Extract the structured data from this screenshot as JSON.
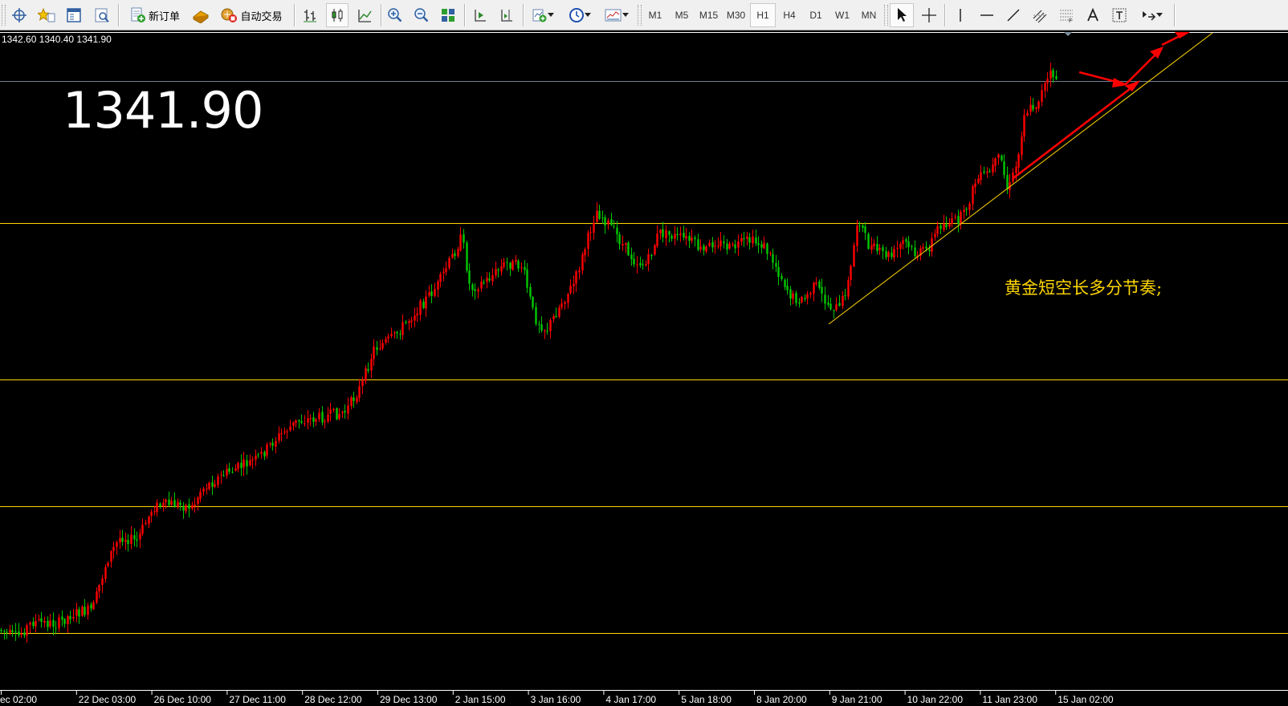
{
  "toolbar": {
    "new_order_label": "新订单",
    "autotrade_label": "自动交易",
    "timeframes": [
      "M1",
      "M5",
      "M15",
      "M30",
      "H1",
      "H4",
      "D1",
      "W1",
      "MN"
    ],
    "active_timeframe": "H1"
  },
  "chart": {
    "ohlc_text": "1342.60 1340.40 1341.90",
    "big_price": "1341.90",
    "annotation": "黄金短空长多分节奏;",
    "x_labels": [
      "ec 02:00",
      "22 Dec 03:00",
      "26 Dec 10:00",
      "27 Dec 11:00",
      "28 Dec 12:00",
      "29 Dec 13:00",
      "2 Jan 15:00",
      "3 Jan 16:00",
      "4 Jan 17:00",
      "5 Jan 18:00",
      "8 Jan 20:00",
      "9 Jan 21:00",
      "10 Jan 22:00",
      "11 Jan 23:00",
      "15 Jan 02:00"
    ],
    "colors": {
      "background": "#000000",
      "bull": "#ff0000",
      "bear": "#00c800",
      "level_line": "#ffd700",
      "trendline": "#ffd700",
      "arrow": "#ff0000",
      "text": "#ffffff",
      "annotation": "#ffd700"
    }
  }
}
